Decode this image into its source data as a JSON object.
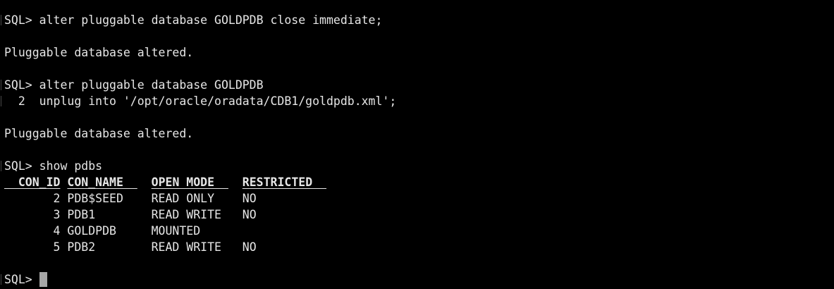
{
  "terminal": {
    "lines": [
      {
        "text": "SQL> alter pluggable database GOLDPDB close immediate;",
        "marked": true
      },
      {
        "text": "",
        "marked": false
      },
      {
        "text": "Pluggable database altered.",
        "marked": false
      },
      {
        "text": "",
        "marked": false
      },
      {
        "text": "SQL> alter pluggable database GOLDPDB",
        "marked": true
      },
      {
        "text": "  2  unplug into '/opt/oracle/oradata/CDB1/goldpdb.xml';",
        "marked": true
      },
      {
        "text": "",
        "marked": false
      },
      {
        "text": "Pluggable database altered.",
        "marked": false
      },
      {
        "text": "",
        "marked": false
      },
      {
        "text": "SQL> show pdbs",
        "marked": true
      }
    ],
    "table": {
      "headers": [
        {
          "text": "  CON_ID",
          "pad": " "
        },
        {
          "text": "CON_NAME  ",
          "pad": "  "
        },
        {
          "text": "OPEN MODE  ",
          "pad": "  "
        },
        {
          "text": "RESTRICTED  ",
          "pad": ""
        }
      ],
      "rows": [
        {
          "con_id": "       2 ",
          "con_name": "PDB$SEED    ",
          "open_mode": "READ ONLY    ",
          "restricted": "NO"
        },
        {
          "con_id": "       3 ",
          "con_name": "PDB1        ",
          "open_mode": "READ WRITE   ",
          "restricted": "NO"
        },
        {
          "con_id": "       4 ",
          "con_name": "GOLDPDB     ",
          "open_mode": "MOUNTED      ",
          "restricted": ""
        },
        {
          "con_id": "       5 ",
          "con_name": "PDB2        ",
          "open_mode": "READ WRITE   ",
          "restricted": "NO"
        }
      ]
    },
    "prompt": "SQL> ",
    "colors": {
      "background": "#000000",
      "foreground": "#e6e6e6",
      "cursor": "#a6a6a6"
    }
  }
}
